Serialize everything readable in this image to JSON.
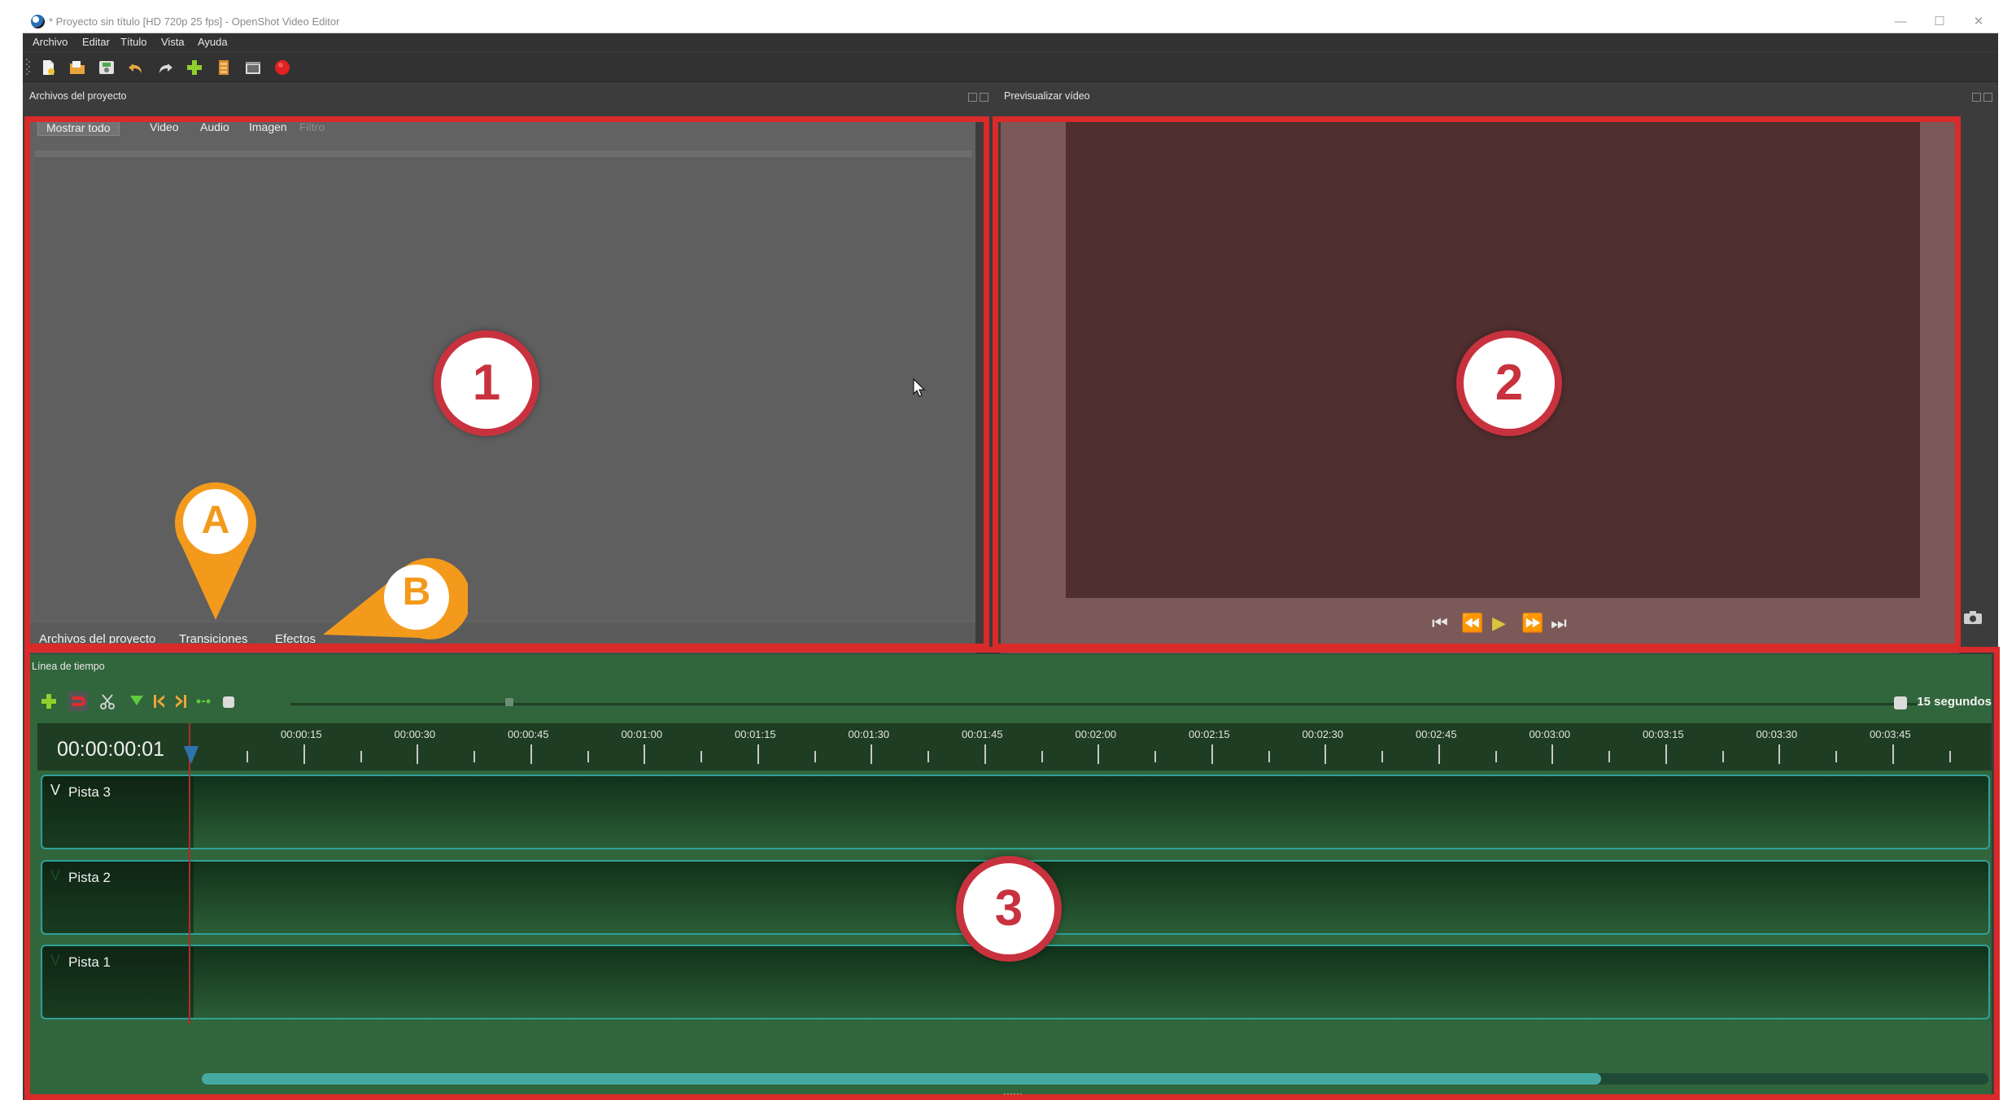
{
  "window": {
    "title": "* Proyecto sin título [HD 720p 25 fps] - OpenShot Video Editor",
    "controls": [
      "—",
      "☐",
      "✕"
    ]
  },
  "menu": [
    "Archivo",
    "Editar",
    "Título",
    "Vista",
    "Ayuda"
  ],
  "toolbar_icons": [
    "new-project",
    "open-project",
    "save-project",
    "undo",
    "redo",
    "import-files",
    "choose-profile",
    "fullscreen",
    "export-video"
  ],
  "project_files": {
    "header": "Archivos del proyecto",
    "filters": [
      "Mostrar todo",
      "Video",
      "Audio",
      "Imagen"
    ],
    "filter_placeholder": "Filtro",
    "bottom_tabs": [
      "Archivos del proyecto",
      "Transiciones",
      "Efectos"
    ]
  },
  "preview": {
    "header": "Previsualizar vídeo",
    "controls": [
      "⏮",
      "⏪",
      "▶",
      "⏩",
      "⏭"
    ]
  },
  "timeline": {
    "header": "Línea de tiempo",
    "zoom_label": "15 segundos",
    "timecode": "00:00:00:01",
    "ruler_labels": [
      "00:00:15",
      "00:00:30",
      "00:00:45",
      "00:01:00",
      "00:01:15",
      "00:01:30",
      "00:01:45",
      "00:02:00",
      "00:02:15",
      "00:02:30",
      "00:02:45",
      "00:03:00",
      "00:03:15",
      "00:03:30",
      "00:03:45"
    ],
    "tracks": [
      "Pista 3",
      "Pista 2",
      "Pista 1"
    ]
  },
  "annotations": {
    "badges": [
      "1",
      "2",
      "3"
    ],
    "pins": [
      "A",
      "B"
    ]
  },
  "colors": {
    "annotation_red": "#da2a2a",
    "badge_red": "#c8323e",
    "pin_orange": "#f39a1d",
    "timeline_green": "#31653b",
    "track_border": "#2fa09a"
  }
}
